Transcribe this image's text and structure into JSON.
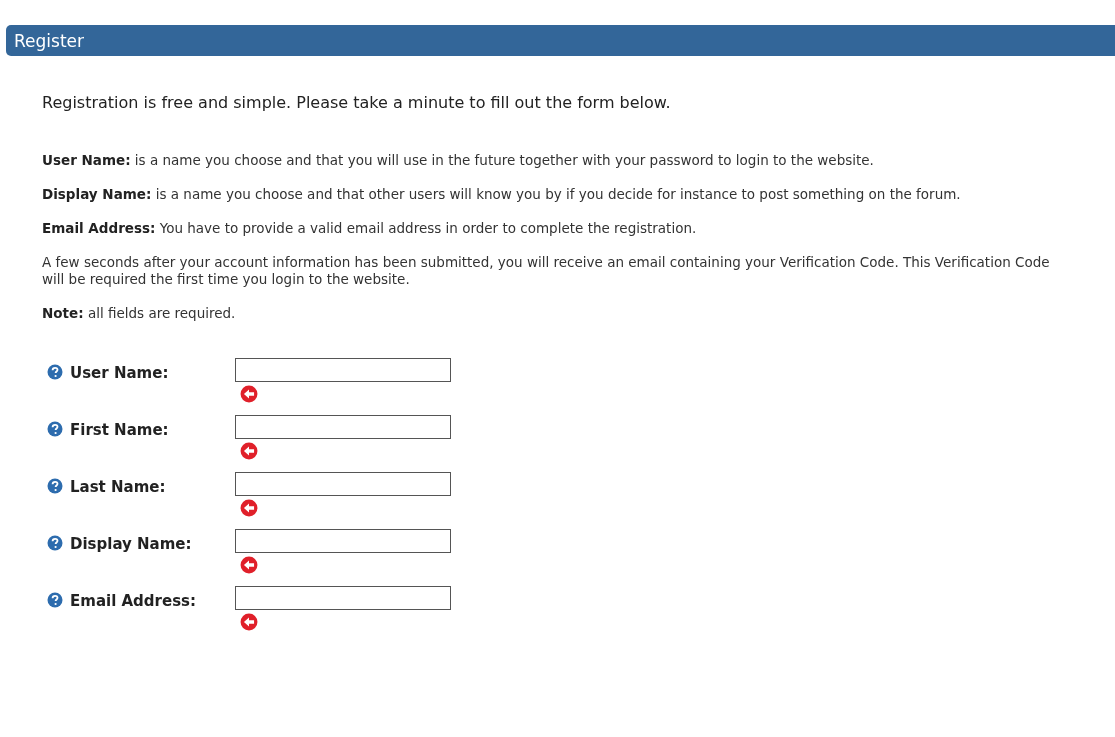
{
  "header": {
    "title": "Register"
  },
  "intro": "Registration is free and simple. Please take a minute to fill out the form below.",
  "paragraphs": [
    "**User Name:** is a name you choose and that you will use in the future together with your password to login to the website.",
    "**Display Name:** is a name you choose and that other users will know you by if you decide for instance to post something on the forum.",
    "**Email Address:** You have to provide a valid email address in order to complete the registration.",
    "A few seconds after your account information has been submitted, you will receive an email containing your Verification Code. This Verification Code will be required the first time you login to the website.",
    "**Note:** all fields are required."
  ],
  "fields": [
    {
      "label": "User Name:",
      "required": true
    },
    {
      "label": "First Name:",
      "required": true
    },
    {
      "label": "Last Name:",
      "required": true
    },
    {
      "label": "Display Name:",
      "required": true
    },
    {
      "label": "Email Address:",
      "required": true
    }
  ]
}
